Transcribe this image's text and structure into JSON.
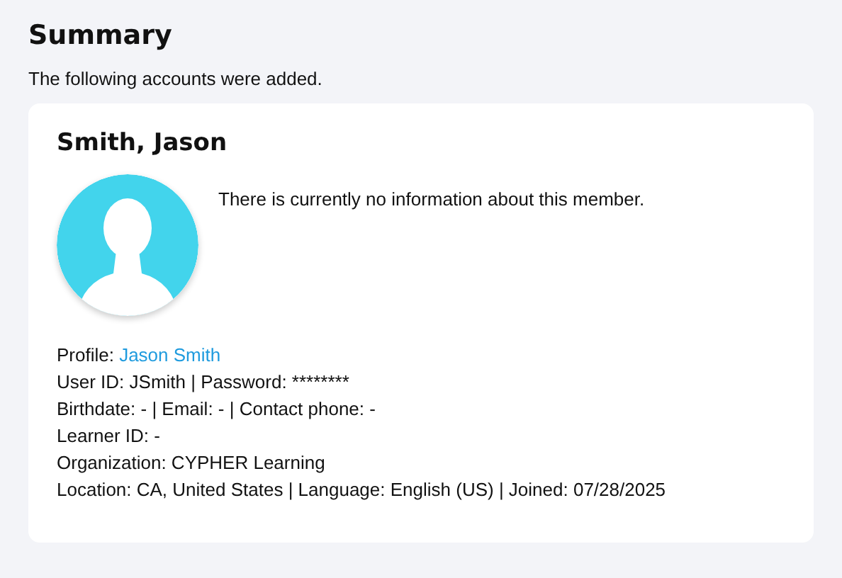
{
  "page": {
    "title": "Summary",
    "subtitle": "The following accounts were added."
  },
  "account": {
    "name": "Smith, Jason",
    "note": "There is currently no information about this member.",
    "details": [
      {
        "kind": "link",
        "label": "Profile:",
        "link": "Jason Smith"
      },
      {
        "kind": "text",
        "text": "User ID: JSmith | Password: ********"
      },
      {
        "kind": "text",
        "text": "Birthdate: - | Email: - | Contact phone: -"
      },
      {
        "kind": "text",
        "text": "Learner ID: -"
      },
      {
        "kind": "text",
        "text": "Organization: CYPHER Learning"
      },
      {
        "kind": "text",
        "text": "Location: CA, United States | Language: English (US) | Joined: 07/28/2025"
      }
    ]
  }
}
